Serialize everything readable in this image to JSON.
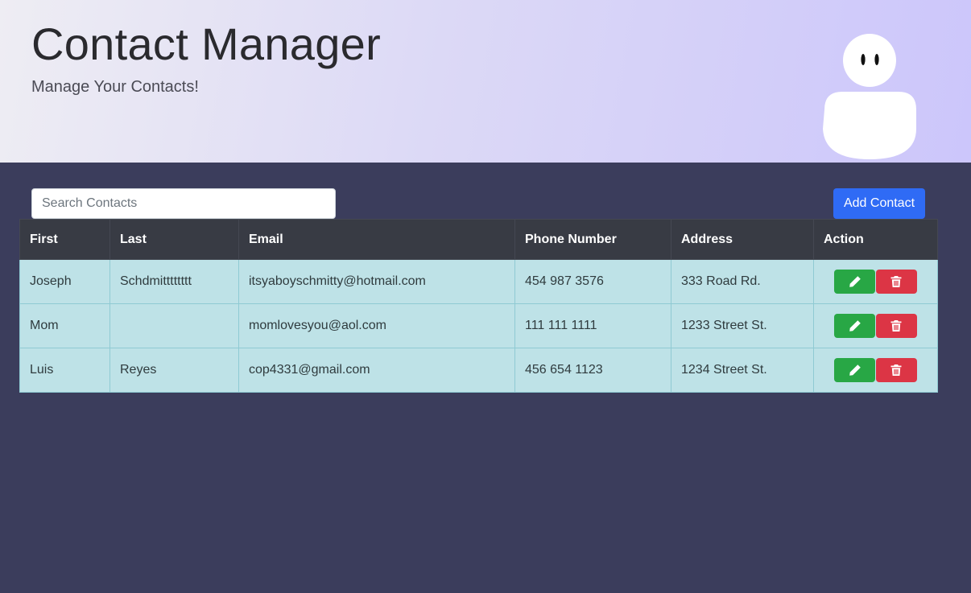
{
  "header": {
    "title": "Contact Manager",
    "subtitle": "Manage Your Contacts!"
  },
  "search": {
    "placeholder": "Search Contacts",
    "value": ""
  },
  "toolbar": {
    "add_label": "Add Contact"
  },
  "table": {
    "columns": [
      "First",
      "Last",
      "Email",
      "Phone Number",
      "Address",
      "Action"
    ],
    "rows": [
      [
        "Joseph",
        "Schdmitttttttt",
        "itsyaboyschmitty@hotmail.com",
        "454 987 3576",
        "333 Road Rd."
      ],
      [
        "Mom",
        "",
        "momlovesyou@aol.com",
        "111 111 1111",
        "1233 Street St."
      ],
      [
        "Luis",
        "Reyes",
        "cop4331@gmail.com",
        "456 654 1123",
        "1234 Street St."
      ]
    ],
    "row_actions": [
      "pencil-icon",
      "trash-icon"
    ]
  },
  "colors": {
    "page_background": "#3b3d5c",
    "header_gradient_start": "#eeedf3",
    "header_gradient_end": "#ccc6fb",
    "add_button": "#2f6bf5",
    "edit_button": "#28a745",
    "delete_button": "#dc3545",
    "table_header": "#383b44",
    "table_row": "#bee2e7"
  }
}
